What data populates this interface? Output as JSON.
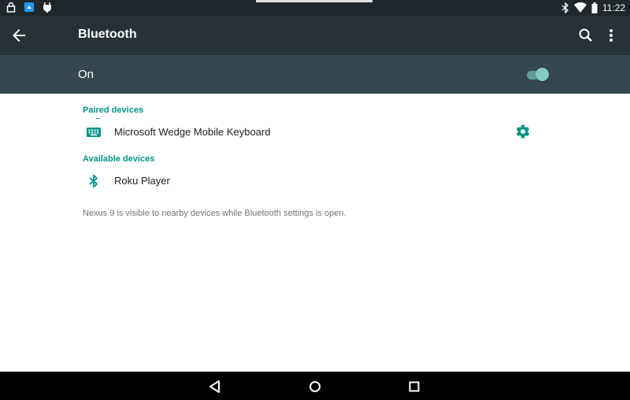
{
  "status_bar": {
    "time": "11:22",
    "left_icons": [
      "lock-icon",
      "app-notification-icon",
      "debug-icon"
    ],
    "right_icons": [
      "bluetooth-icon",
      "wifi-icon",
      "battery-icon"
    ]
  },
  "app_bar": {
    "title": "Bluetooth",
    "back_icon": "arrow-back-icon",
    "search_icon": "search-icon",
    "more_icon": "more-vert-icon"
  },
  "master_toggle": {
    "label": "On",
    "state": true
  },
  "paired": {
    "header": "Paired devices",
    "devices": [
      {
        "name": "Microsoft Wedge Mobile Keyboard",
        "icon": "keyboard-icon",
        "action_icon": "gear-icon"
      }
    ]
  },
  "available": {
    "header": "Available devices",
    "devices": [
      {
        "name": "Roku Player",
        "icon": "bluetooth-icon"
      }
    ]
  },
  "info": "Nexus 9 is visible to nearby devices while Bluetooth settings is open.",
  "nav_bar": {
    "icons": [
      "nav-back-icon",
      "nav-home-icon",
      "nav-recents-icon"
    ]
  },
  "colors": {
    "accent": "#009688",
    "app_bar": "#263238",
    "toggle_bar": "#37474f",
    "switch_thumb": "#80cbc4"
  }
}
